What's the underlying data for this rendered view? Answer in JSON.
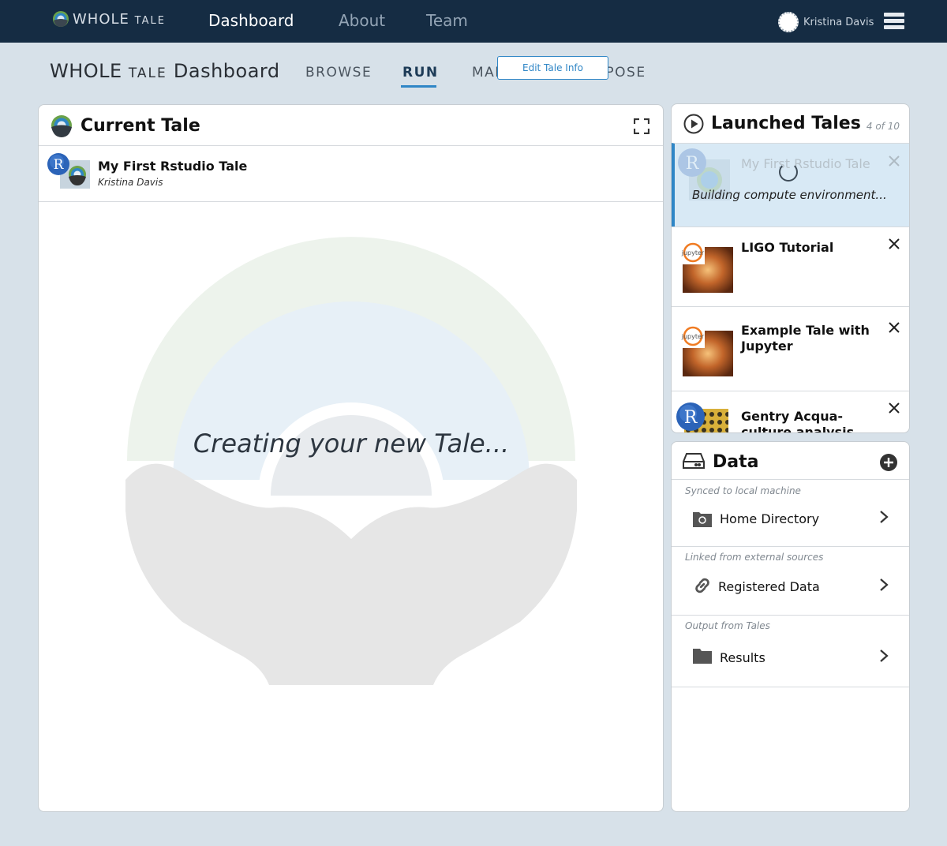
{
  "topbar": {
    "logo": {
      "word1": "WHOLE",
      "word2": "TALE"
    },
    "nav": [
      {
        "label": "Dashboard",
        "active": true
      },
      {
        "label": "About",
        "active": false
      },
      {
        "label": "Team",
        "active": false
      }
    ],
    "user": {
      "name": "Kristina Davis"
    },
    "menu_icon": "hamburger-stack-icon"
  },
  "subheader": {
    "brand": {
      "word1": "WHOLE",
      "word2": "TALE",
      "word3": "Dashboard"
    },
    "tabs": [
      {
        "label": "BROWSE",
        "active": false
      },
      {
        "label": "RUN",
        "active": true
      },
      {
        "label": "MANAGE",
        "active": false
      },
      {
        "label": "COMPOSE",
        "active": false
      }
    ]
  },
  "current_tale": {
    "title": "Current Tale",
    "tale": {
      "name": "My First Rstudio Tale",
      "author": "Kristina Davis",
      "edit_label": "Edit Tale Info"
    },
    "status": "Creating your new Tale..."
  },
  "launched_tales": {
    "title": "Launched Tales",
    "count": "4 of 10",
    "items": [
      {
        "name": "My First Rstudio Tale",
        "status": "Building compute environment...",
        "thumb": "rstudio",
        "building": true
      },
      {
        "name": "LIGO Tutorial",
        "thumb": "jupyter",
        "building": false
      },
      {
        "name": "Example Tale with Jupyter",
        "thumb": "jupyter",
        "building": false
      },
      {
        "name": "Gentry Acqua-culture analysis",
        "thumb": "rstudio",
        "building": false
      }
    ]
  },
  "data_panel": {
    "title": "Data",
    "sections": [
      {
        "caption": "Synced to local machine",
        "label": "Home Directory",
        "icon": "folder-sync-icon"
      },
      {
        "caption": "Linked from external sources",
        "label": "Registered Data",
        "icon": "link-icon"
      },
      {
        "caption": "Output from Tales",
        "label": "Results",
        "icon": "folder-icon"
      }
    ]
  },
  "colors": {
    "topbar": "#152c43",
    "background": "#d7e1e9",
    "accent": "#2f86c6"
  }
}
